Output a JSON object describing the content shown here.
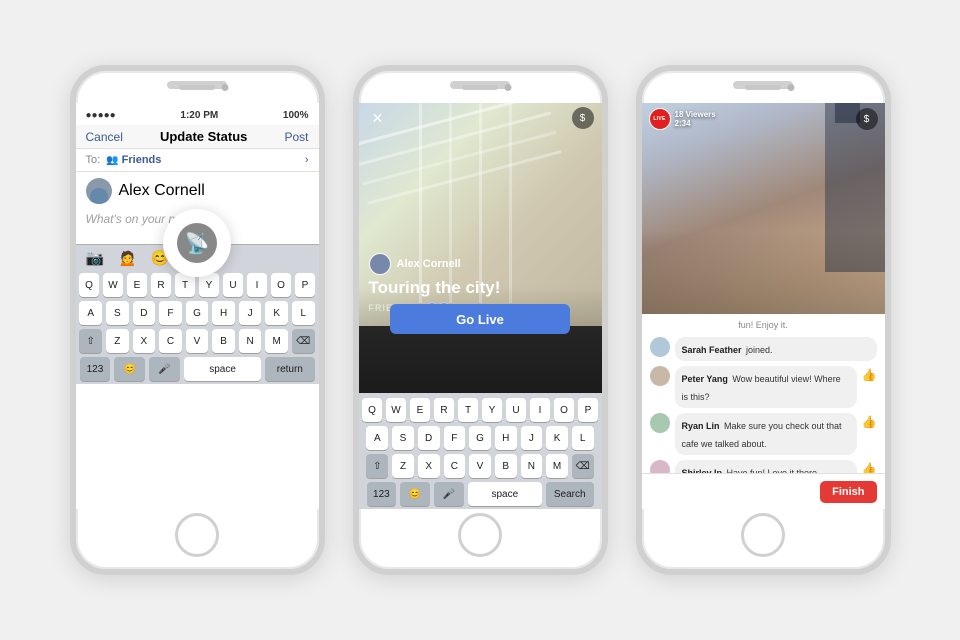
{
  "background": "#f0f0f0",
  "phone1": {
    "statusbar": {
      "signal": "●●●●●",
      "wifi": "▾",
      "time": "1:20 PM",
      "battery": "100%"
    },
    "navbar": {
      "cancel": "Cancel",
      "title": "Update Status",
      "post": "Post"
    },
    "to_row": {
      "label": "To:",
      "audience": "Friends",
      "chevron": "›"
    },
    "user": {
      "name": "Alex Cornell"
    },
    "placeholder": "What's on your mind?",
    "keyboard_rows": [
      [
        "Q",
        "W",
        "E",
        "R",
        "T",
        "Y",
        "U",
        "I",
        "O",
        "P"
      ],
      [
        "A",
        "S",
        "D",
        "F",
        "G",
        "H",
        "J",
        "K",
        "L"
      ],
      [
        "⇧",
        "Z",
        "X",
        "C",
        "V",
        "B",
        "N",
        "M",
        "⌫"
      ],
      [
        "123",
        "😊",
        "🎤",
        "space",
        "return"
      ]
    ]
  },
  "phone2": {
    "close_icon": "✕",
    "share_icon": "$",
    "user": {
      "name": "Alex Cornell"
    },
    "title": "Touring the city!",
    "audience_label": "FRIENDS",
    "go_live_label": "Go Live",
    "keyboard_rows": [
      [
        "Q",
        "W",
        "E",
        "R",
        "T",
        "Y",
        "U",
        "I",
        "O",
        "P"
      ],
      [
        "A",
        "S",
        "D",
        "F",
        "G",
        "H",
        "J",
        "K",
        "L"
      ],
      [
        "⇧",
        "Z",
        "X",
        "C",
        "V",
        "B",
        "N",
        "M",
        "⌫"
      ],
      [
        "123",
        "😊",
        "🎤",
        "space",
        "Search"
      ]
    ]
  },
  "phone3": {
    "live_label": "Live",
    "viewers": "18 Viewers",
    "timer": "2:34",
    "share_icon": "$",
    "comment_intro": "fun! Enjoy it.",
    "comments": [
      {
        "name": "Sarah Feather",
        "text": "joined."
      },
      {
        "name": "Peter Yang",
        "text": "Wow beautiful view! Where is this?"
      },
      {
        "name": "Ryan Lin",
        "text": "Make sure you check out that cafe we talked about."
      },
      {
        "name": "Shirley Ip",
        "text": "Have fun! Love it there."
      }
    ],
    "finish_label": "Finish"
  }
}
